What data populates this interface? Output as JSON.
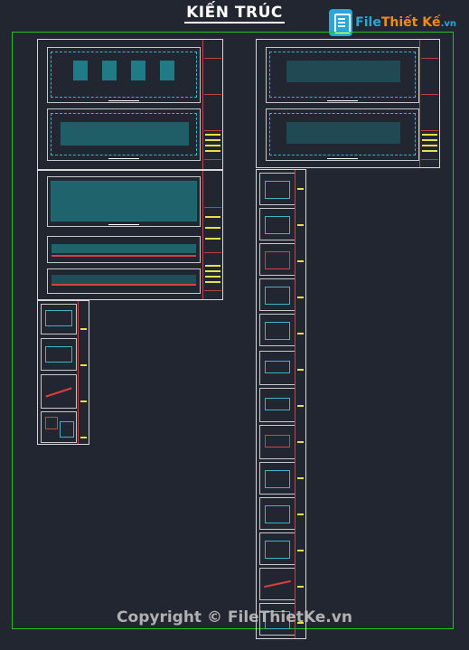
{
  "header": {
    "title": "KIẾN TRÚC"
  },
  "logo": {
    "part1": "File",
    "part2": "Thiết Kế",
    "part3": ".vn"
  },
  "watermark": {
    "text": "Copyright © FileThietKe.vn"
  },
  "colors": {
    "background": "#222630",
    "frame": "#23c41e",
    "accent_yellow": "#e8e04a",
    "accent_teal": "#1e8c96",
    "accent_red": "#d84040"
  }
}
